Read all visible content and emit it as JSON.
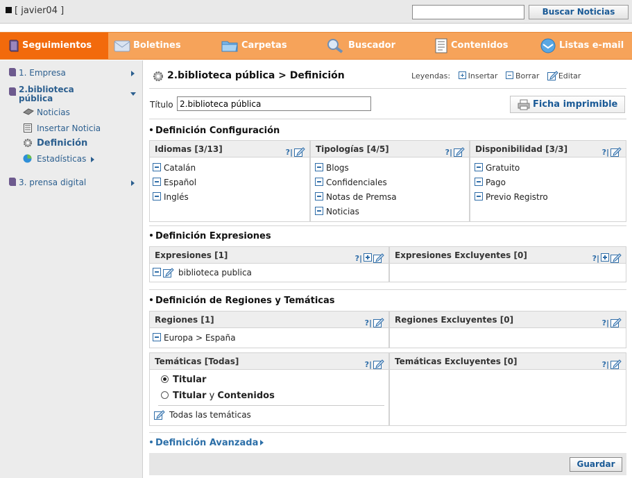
{
  "topbar": {
    "user": "[ javier04 ]",
    "search_value": "",
    "search_button": "Buscar Noticias"
  },
  "nav": {
    "items": [
      {
        "label": "Seguimientos",
        "icon": "book-icon",
        "active": true
      },
      {
        "label": "Boletines",
        "icon": "envelope-icon"
      },
      {
        "label": "Carpetas",
        "icon": "folder-icon"
      },
      {
        "label": "Buscador",
        "icon": "magnifier-icon"
      },
      {
        "label": "Contenidos",
        "icon": "document-icon"
      },
      {
        "label": "Listas e-mail",
        "icon": "email-list-icon"
      }
    ]
  },
  "sidebar": {
    "items": [
      {
        "label": "1. Empresa"
      },
      {
        "label": "2.biblioteca pública",
        "line1": "2.biblioteca",
        "line2": "pública"
      },
      {
        "label": "Noticias"
      },
      {
        "label": "Insertar Noticia"
      },
      {
        "label": "Definición"
      },
      {
        "label": "Estadísticas"
      },
      {
        "label": "3. prensa digital"
      }
    ]
  },
  "main": {
    "page_title": "2.biblioteca pública > Definición",
    "legend_label": "Leyendas:",
    "legend_insert": "Insertar",
    "legend_delete": "Borrar",
    "legend_edit": "Editar",
    "title_label": "Título",
    "title_value": "2.biblioteca pública",
    "print_button": "Ficha imprimible",
    "sections": {
      "config": "Definición Configuración",
      "expressions": "Definición Expresiones",
      "regions": "Definición de Regiones y Temáticas",
      "advanced": "Definición Avanzada"
    },
    "idiomas": {
      "header": "Idiomas [3/13]",
      "items": [
        "Catalán",
        "Español",
        "Inglés"
      ]
    },
    "tipologias": {
      "header": "Tipologías [4/5]",
      "items": [
        "Blogs",
        "Confidenciales",
        "Notas de Premsa",
        "Noticias"
      ]
    },
    "disponibilidad": {
      "header": "Disponibilidad [3/3]",
      "items": [
        "Gratuito",
        "Pago",
        "Previo Registro"
      ]
    },
    "expresiones": {
      "header": "Expresiones [1]",
      "items": [
        "biblioteca publica"
      ]
    },
    "expresiones_excl": {
      "header": "Expresiones Excluyentes [0]"
    },
    "regiones": {
      "header": "Regiones [1]",
      "items": [
        "Europa > España"
      ]
    },
    "regiones_excl": {
      "header": "Regiones Excluyentes [0]"
    },
    "tematicas": {
      "header": "Temáticas [Todas]",
      "radio1": "Titular",
      "radio2_a": "Titular",
      "radio2_b": " y ",
      "radio2_c": "Contenidos",
      "all": "Todas las temáticas"
    },
    "tematicas_excl": {
      "header": "Temáticas Excluyentes [0]"
    },
    "help_glyph": "?|",
    "save_button": "Guardar"
  }
}
